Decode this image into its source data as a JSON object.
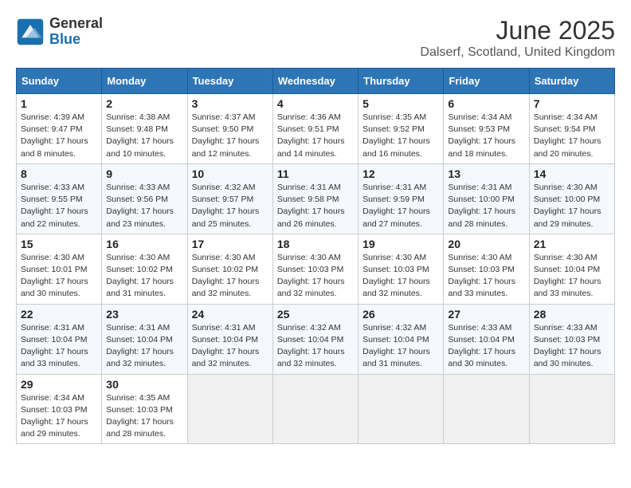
{
  "header": {
    "logo_general": "General",
    "logo_blue": "Blue",
    "month_title": "June 2025",
    "location": "Dalserf, Scotland, United Kingdom"
  },
  "calendar": {
    "days_of_week": [
      "Sunday",
      "Monday",
      "Tuesday",
      "Wednesday",
      "Thursday",
      "Friday",
      "Saturday"
    ],
    "weeks": [
      [
        null,
        null,
        null,
        null,
        null,
        null,
        null
      ]
    ],
    "cells": [
      {
        "day": null,
        "empty": true
      },
      {
        "day": null,
        "empty": true
      },
      {
        "day": null,
        "empty": true
      },
      {
        "day": null,
        "empty": true
      },
      {
        "day": null,
        "empty": true
      },
      {
        "day": null,
        "empty": true
      },
      {
        "day": null,
        "empty": true
      }
    ]
  },
  "days": [
    {
      "num": "1",
      "sunrise": "4:39 AM",
      "sunset": "9:47 PM",
      "daylight": "17 hours and 8 minutes."
    },
    {
      "num": "2",
      "sunrise": "4:38 AM",
      "sunset": "9:48 PM",
      "daylight": "17 hours and 10 minutes."
    },
    {
      "num": "3",
      "sunrise": "4:37 AM",
      "sunset": "9:50 PM",
      "daylight": "17 hours and 12 minutes."
    },
    {
      "num": "4",
      "sunrise": "4:36 AM",
      "sunset": "9:51 PM",
      "daylight": "17 hours and 14 minutes."
    },
    {
      "num": "5",
      "sunrise": "4:35 AM",
      "sunset": "9:52 PM",
      "daylight": "17 hours and 16 minutes."
    },
    {
      "num": "6",
      "sunrise": "4:34 AM",
      "sunset": "9:53 PM",
      "daylight": "17 hours and 18 minutes."
    },
    {
      "num": "7",
      "sunrise": "4:34 AM",
      "sunset": "9:54 PM",
      "daylight": "17 hours and 20 minutes."
    },
    {
      "num": "8",
      "sunrise": "4:33 AM",
      "sunset": "9:55 PM",
      "daylight": "17 hours and 22 minutes."
    },
    {
      "num": "9",
      "sunrise": "4:33 AM",
      "sunset": "9:56 PM",
      "daylight": "17 hours and 23 minutes."
    },
    {
      "num": "10",
      "sunrise": "4:32 AM",
      "sunset": "9:57 PM",
      "daylight": "17 hours and 25 minutes."
    },
    {
      "num": "11",
      "sunrise": "4:31 AM",
      "sunset": "9:58 PM",
      "daylight": "17 hours and 26 minutes."
    },
    {
      "num": "12",
      "sunrise": "4:31 AM",
      "sunset": "9:59 PM",
      "daylight": "17 hours and 27 minutes."
    },
    {
      "num": "13",
      "sunrise": "4:31 AM",
      "sunset": "10:00 PM",
      "daylight": "17 hours and 28 minutes."
    },
    {
      "num": "14",
      "sunrise": "4:30 AM",
      "sunset": "10:00 PM",
      "daylight": "17 hours and 29 minutes."
    },
    {
      "num": "15",
      "sunrise": "4:30 AM",
      "sunset": "10:01 PM",
      "daylight": "17 hours and 30 minutes."
    },
    {
      "num": "16",
      "sunrise": "4:30 AM",
      "sunset": "10:02 PM",
      "daylight": "17 hours and 31 minutes."
    },
    {
      "num": "17",
      "sunrise": "4:30 AM",
      "sunset": "10:02 PM",
      "daylight": "17 hours and 32 minutes."
    },
    {
      "num": "18",
      "sunrise": "4:30 AM",
      "sunset": "10:03 PM",
      "daylight": "17 hours and 32 minutes."
    },
    {
      "num": "19",
      "sunrise": "4:30 AM",
      "sunset": "10:03 PM",
      "daylight": "17 hours and 32 minutes."
    },
    {
      "num": "20",
      "sunrise": "4:30 AM",
      "sunset": "10:03 PM",
      "daylight": "17 hours and 33 minutes."
    },
    {
      "num": "21",
      "sunrise": "4:30 AM",
      "sunset": "10:04 PM",
      "daylight": "17 hours and 33 minutes."
    },
    {
      "num": "22",
      "sunrise": "4:31 AM",
      "sunset": "10:04 PM",
      "daylight": "17 hours and 33 minutes."
    },
    {
      "num": "23",
      "sunrise": "4:31 AM",
      "sunset": "10:04 PM",
      "daylight": "17 hours and 32 minutes."
    },
    {
      "num": "24",
      "sunrise": "4:31 AM",
      "sunset": "10:04 PM",
      "daylight": "17 hours and 32 minutes."
    },
    {
      "num": "25",
      "sunrise": "4:32 AM",
      "sunset": "10:04 PM",
      "daylight": "17 hours and 32 minutes."
    },
    {
      "num": "26",
      "sunrise": "4:32 AM",
      "sunset": "10:04 PM",
      "daylight": "17 hours and 31 minutes."
    },
    {
      "num": "27",
      "sunrise": "4:33 AM",
      "sunset": "10:04 PM",
      "daylight": "17 hours and 30 minutes."
    },
    {
      "num": "28",
      "sunrise": "4:33 AM",
      "sunset": "10:03 PM",
      "daylight": "17 hours and 30 minutes."
    },
    {
      "num": "29",
      "sunrise": "4:34 AM",
      "sunset": "10:03 PM",
      "daylight": "17 hours and 29 minutes."
    },
    {
      "num": "30",
      "sunrise": "4:35 AM",
      "sunset": "10:03 PM",
      "daylight": "17 hours and 28 minutes."
    }
  ]
}
